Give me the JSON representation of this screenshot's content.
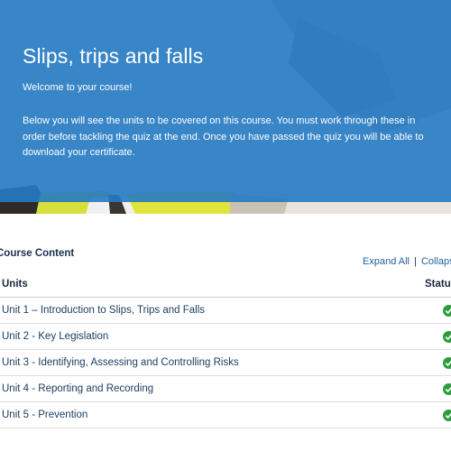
{
  "hero": {
    "title": "Slips, trips and falls",
    "welcome": "Welcome to your course!",
    "intro": "Below you will see the units to be covered on this course. You must work through these in order before tackling the quiz at the end. Once you have passed the quiz you will be able to download your certificate."
  },
  "content": {
    "title": "Course Content",
    "expand_all": "Expand All",
    "separator": "|",
    "collapse_all": "Collapse All",
    "col_units": "Units",
    "col_status": "Status",
    "units": [
      {
        "label": "Unit 1 – Introduction to Slips, Trips and Falls",
        "status_icon": "check-circle-icon"
      },
      {
        "label": "Unit 2 - Key Legislation",
        "status_icon": "check-circle-icon"
      },
      {
        "label": "Unit 3 - Identifying, Assessing and Controlling Risks",
        "status_icon": "check-circle-icon"
      },
      {
        "label": "Unit 4 - Reporting and Recording",
        "status_icon": "check-circle-icon"
      },
      {
        "label": "Unit 5 - Prevention",
        "status_icon": "check-circle-icon"
      }
    ]
  },
  "colors": {
    "banner_blue": "#257ac4",
    "heading_navy": "#1a3050",
    "link_blue": "#1f5f9a",
    "status_green": "#2e9c3e",
    "vest_yellow": "#d6e03a"
  }
}
